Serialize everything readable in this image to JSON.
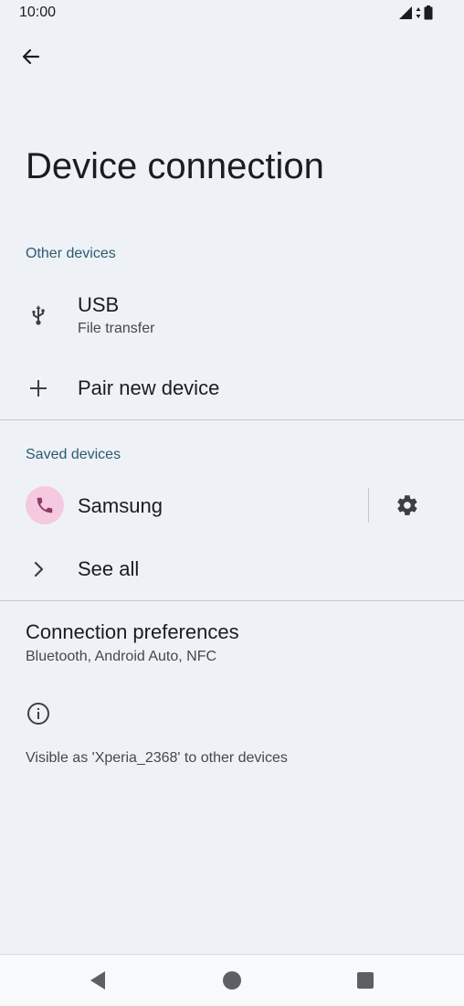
{
  "status_bar": {
    "time": "10:00"
  },
  "icons": {
    "back": "arrow-left-icon",
    "usb": "usb-icon",
    "pair": "plus-icon",
    "phone": "phone-icon",
    "settings": "gear-icon",
    "see_all": "chevron-right-icon",
    "info": "info-icon"
  },
  "page": {
    "title": "Device connection"
  },
  "other_devices": {
    "header": "Other devices",
    "usb_title": "USB",
    "usb_subtitle": "File transfer",
    "pair_label": "Pair new device"
  },
  "saved_devices": {
    "header": "Saved devices",
    "device_name": "Samsung",
    "see_all_label": "See all"
  },
  "connection_preferences": {
    "title": "Connection preferences",
    "subtitle": "Bluetooth, Android Auto, NFC"
  },
  "footer_info": {
    "text": "Visible as 'Xperia_2368' to other devices"
  },
  "colors": {
    "background": "#eef2f6",
    "section_header": "#2c5a71",
    "avatar_bg": "#f5c9df",
    "avatar_icon": "#8c3a6b"
  }
}
